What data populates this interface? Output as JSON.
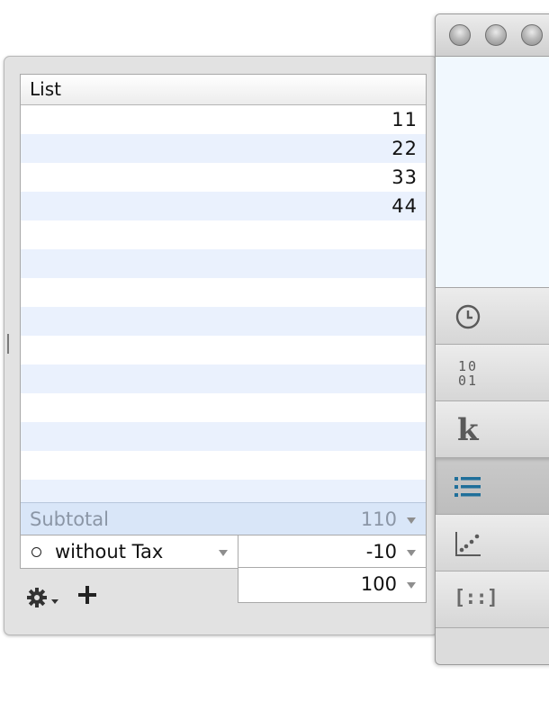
{
  "list": {
    "header": "List",
    "rows": [
      "11",
      "22",
      "33",
      "44",
      "",
      "",
      "",
      "",
      "",
      "",
      "",
      "",
      "",
      ""
    ]
  },
  "subtotal": {
    "label": "Subtotal",
    "value": "110"
  },
  "tax": {
    "option": "without Tax",
    "value": "-10"
  },
  "total": {
    "value": "100"
  },
  "toolbar": {
    "gear_icon": "gear-icon",
    "add_icon": "plus-icon"
  },
  "window": {
    "traffic_lights": [
      "close",
      "minimize",
      "zoom"
    ],
    "tabs": [
      {
        "name": "history",
        "icon": "clock-icon"
      },
      {
        "name": "binary",
        "icon": "binary-icon",
        "glyph_line1": "10",
        "glyph_line2": "01"
      },
      {
        "name": "constants",
        "icon": "k-icon",
        "glyph": "k"
      },
      {
        "name": "list",
        "icon": "list-icon",
        "active": true
      },
      {
        "name": "statistics",
        "icon": "scatter-icon"
      },
      {
        "name": "matrix",
        "icon": "matrix-icon",
        "glyph": "[::]"
      }
    ]
  },
  "colors": {
    "accent": "#1f6f9a",
    "row_alt": "#eaf1fd",
    "subtotal_bg": "#d9e6f8",
    "display_bg": "#f1f8fe"
  }
}
